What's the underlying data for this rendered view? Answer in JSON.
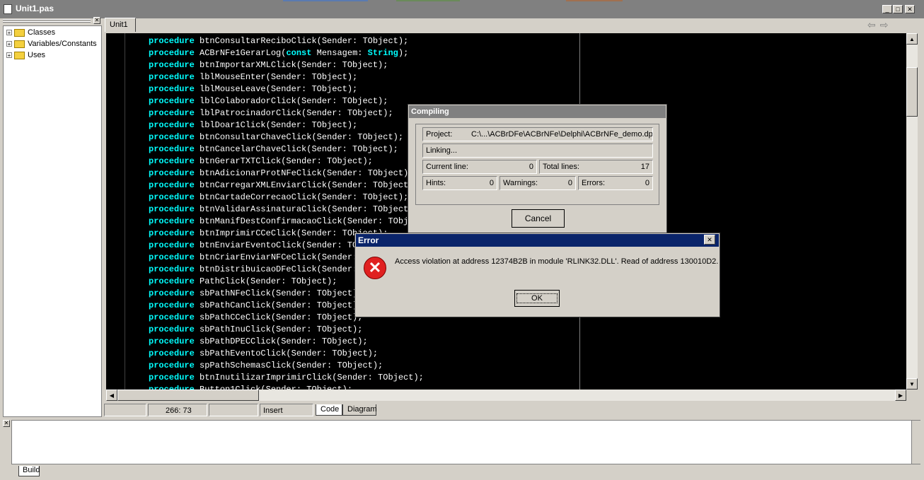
{
  "window": {
    "title": "Unit1.pas"
  },
  "tree": {
    "items": [
      "Classes",
      "Variables/Constants",
      "Uses"
    ]
  },
  "tabs": {
    "active": "Unit1"
  },
  "editor": {
    "keyword": "procedure",
    "lines": [
      [
        "procedure",
        " btnConsultarReciboClick(Sender: TObject);"
      ],
      [
        "procedure",
        " ACBrNFe1GerarLog(",
        "const",
        " Mensagem: ",
        "String",
        ");"
      ],
      [
        "procedure",
        " btnImportarXMLClick(Sender: TObject);"
      ],
      [
        "procedure",
        " lblMouseEnter(Sender: TObject);"
      ],
      [
        "procedure",
        " lblMouseLeave(Sender: TObject);"
      ],
      [
        "procedure",
        " lblColaboradorClick(Sender: TObject);"
      ],
      [
        "procedure",
        " lblPatrocinadorClick(Sender: TObject);"
      ],
      [
        "procedure",
        " lblDoar1Click(Sender: TObject);"
      ],
      [
        "procedure",
        " btnConsultarChaveClick(Sender: TObject);"
      ],
      [
        "procedure",
        " btnCancelarChaveClick(Sender: TObject);"
      ],
      [
        "procedure",
        " btnGerarTXTClick(Sender: TObject);"
      ],
      [
        "procedure",
        " btnAdicionarProtNFeClick(Sender: TObject);"
      ],
      [
        "procedure",
        " btnCarregarXMLEnviarClick(Sender: TObject);"
      ],
      [
        "procedure",
        " btnCartadeCorrecaoClick(Sender: TObject);"
      ],
      [
        "procedure",
        " btnValidarAssinaturaClick(Sender: TObject);"
      ],
      [
        "procedure",
        " btnManifDestConfirmacaoClick(Sender: TObject);"
      ],
      [
        "procedure",
        " btnImprimirCCeClick(Sender: TObject);"
      ],
      [
        "procedure",
        " btnEnviarEventoClick(Sender: TObject);"
      ],
      [
        "procedure",
        " btnCriarEnviarNFCeClick(Sender: TObject);"
      ],
      [
        "procedure",
        " btnDistribuicaoDFeClick(Sender: TObject);"
      ],
      [
        "procedure",
        " PathClick(Sender: TObject);"
      ],
      [
        "procedure",
        " sbPathNFeClick(Sender: TObject);"
      ],
      [
        "procedure",
        " sbPathCanClick(Sender: TObject);"
      ],
      [
        "procedure",
        " sbPathCCeClick(Sender: TObject);"
      ],
      [
        "procedure",
        " sbPathInuClick(Sender: TObject);"
      ],
      [
        "procedure",
        " sbPathDPECClick(Sender: TObject);"
      ],
      [
        "procedure",
        " sbPathEventoClick(Sender: TObject);"
      ],
      [
        "procedure",
        " spPathSchemasClick(Sender: TObject);"
      ],
      [
        "procedure",
        " btnInutilizarImprimirClick(Sender: TObject);"
      ],
      [
        "procedure",
        " Button1Click(Sender: TObject);"
      ]
    ]
  },
  "status": {
    "position": "266:  73",
    "mode": "Insert",
    "tab_code": "Code",
    "tab_diagram": "Diagram"
  },
  "messages": {
    "tab_build": "Build"
  },
  "compiling": {
    "title": "Compiling",
    "project_label": "Project:",
    "project_value": "C:\\...\\ACBrDFe\\ACBrNFe\\Delphi\\ACBrNFe_demo.dpr",
    "state": "Linking...",
    "current_line_label": "Current line:",
    "current_line": "0",
    "total_lines_label": "Total lines:",
    "total_lines": "17",
    "hints_label": "Hints:",
    "hints": "0",
    "warnings_label": "Warnings:",
    "warnings": "0",
    "errors_label": "Errors:",
    "errors": "0",
    "cancel": "Cancel"
  },
  "error": {
    "title": "Error",
    "message": "Access violation at address 12374B2B in module 'RLINK32.DLL'. Read of address 130010D2.",
    "ok": "OK",
    "icon": "error-icon"
  },
  "colors": {
    "keyword": "#00ffff",
    "code_bg": "#000000",
    "error_title_bg": "#0a246a"
  }
}
